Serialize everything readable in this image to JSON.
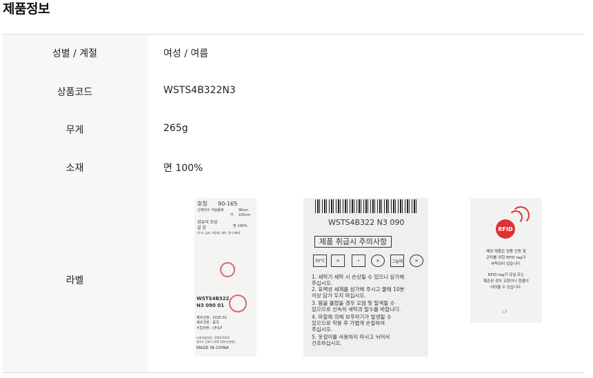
{
  "page": {
    "title": "제품정보"
  },
  "rows": [
    {
      "label": "성별 / 계절",
      "value": "여성 / 여름"
    },
    {
      "label": "상품코드",
      "value": "WSTS4B322N3"
    },
    {
      "label": "무게",
      "value": "265g"
    },
    {
      "label": "소재",
      "value": "면 100%"
    },
    {
      "label": "라벨",
      "value": ""
    }
  ],
  "label_images": {
    "size_tag": {
      "size_label": "호칭",
      "size_value": "90-165",
      "body_line1": "신체치수 가슴둘레",
      "chest": "90cm",
      "body_line2": "키",
      "height": "165cm",
      "composition_title": "섬유의 조성",
      "composition_item": "겉  감",
      "composition_value": "면   100%",
      "composition_note": "(도커, 심포, 보강재, 재수, 장식 제외)",
      "product_code": "WSTS4B322",
      "product_code2": "N3 090 01",
      "made_date": "제조년월 : 2025.01",
      "made_country": "제조국명 : 중국",
      "importer": "수입자명 : (주)LF",
      "cs_phone": "소비자상담실 : 1544-5114",
      "address": "경기도 군포시 LS로 161(산본동)",
      "origin": "MADE IN CHINA"
    },
    "care_tag": {
      "code": "WSTS4B322 N3 090",
      "title": "제품 취급시 주의사항",
      "icon_wash": "손세탁",
      "icon_temp": "30°C",
      "icon_dry": "약하게",
      "icon_notes": "그늘에",
      "lines": [
        "1. 세탁기 세탁 시 손상될 수 있으니 삼가해",
        "   주십시오.",
        "2. 표백성 세제를 삼가해 주시고 물에 10분",
        "   이상 담가 두지 마십시오.",
        "3. 땀을 흘렸을 경우 오염 및 탈색될 수",
        "   있으므로 신속히 세탁과 탈수를 바랍니다.",
        "4. 마찰에 의해 보푸라기가 발생될 수",
        "   있으므로 착용 후 가볍게 손질하여",
        "   주십시오.",
        "5. 옷걸이를 사용하지 마시고 뉘어서",
        "   건조하십시오."
      ]
    },
    "rfid_tag": {
      "badge": "RFID",
      "text1": "해당 제품은 정품 인증 및",
      "text2": "관리를 위한 RFID tag가",
      "text3": "부착되어 있습니다.",
      "text4": "RFID tag가 유실 또는",
      "text5": "훼손된 경우 교환이나 환불이",
      "text6": "어려울 수 있습니다.",
      "brand": "LF"
    }
  }
}
